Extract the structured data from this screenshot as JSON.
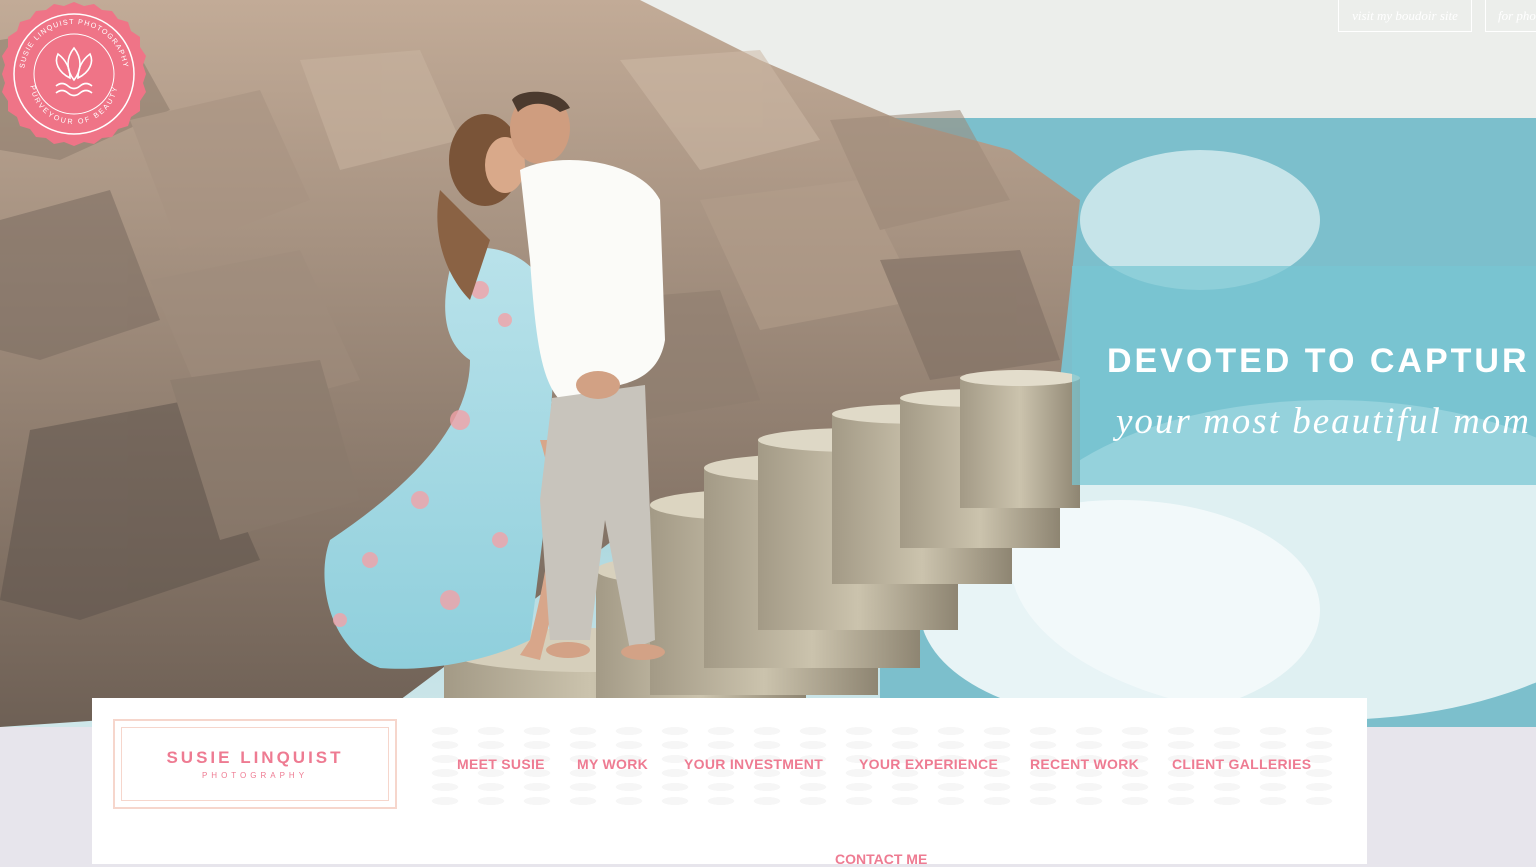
{
  "top_links": [
    {
      "label": "visit my boudoir site"
    },
    {
      "label": "for pho"
    }
  ],
  "tagline": {
    "main": "DEVOTED TO CAPTUR",
    "sub": "your most beautiful mom"
  },
  "seal": {
    "ring_text_top": "SUSIE LINQUIST PHOTOGRAPHY",
    "ring_text_bottom": "PURVEYOUR OF BEAUTY",
    "icon": "lotus-wave-icon",
    "color": "#ef7487"
  },
  "logo": {
    "name": "SUSIE LINQUIST",
    "sub": "PHOTOGRAPHY"
  },
  "nav": {
    "items": [
      {
        "label": "MEET SUSIE"
      },
      {
        "label": "MY WORK"
      },
      {
        "label": "YOUR INVESTMENT"
      },
      {
        "label": "YOUR EXPERIENCE"
      },
      {
        "label": "RECENT WORK"
      },
      {
        "label": "CLIENT GALLERIES"
      },
      {
        "label": "CONTACT ME"
      }
    ]
  },
  "colors": {
    "accent_pink": "#ee7b92",
    "logo_border": "#f6d6cc",
    "banner_teal": "#78c6d2",
    "page_bg": "#e7e5ec"
  }
}
